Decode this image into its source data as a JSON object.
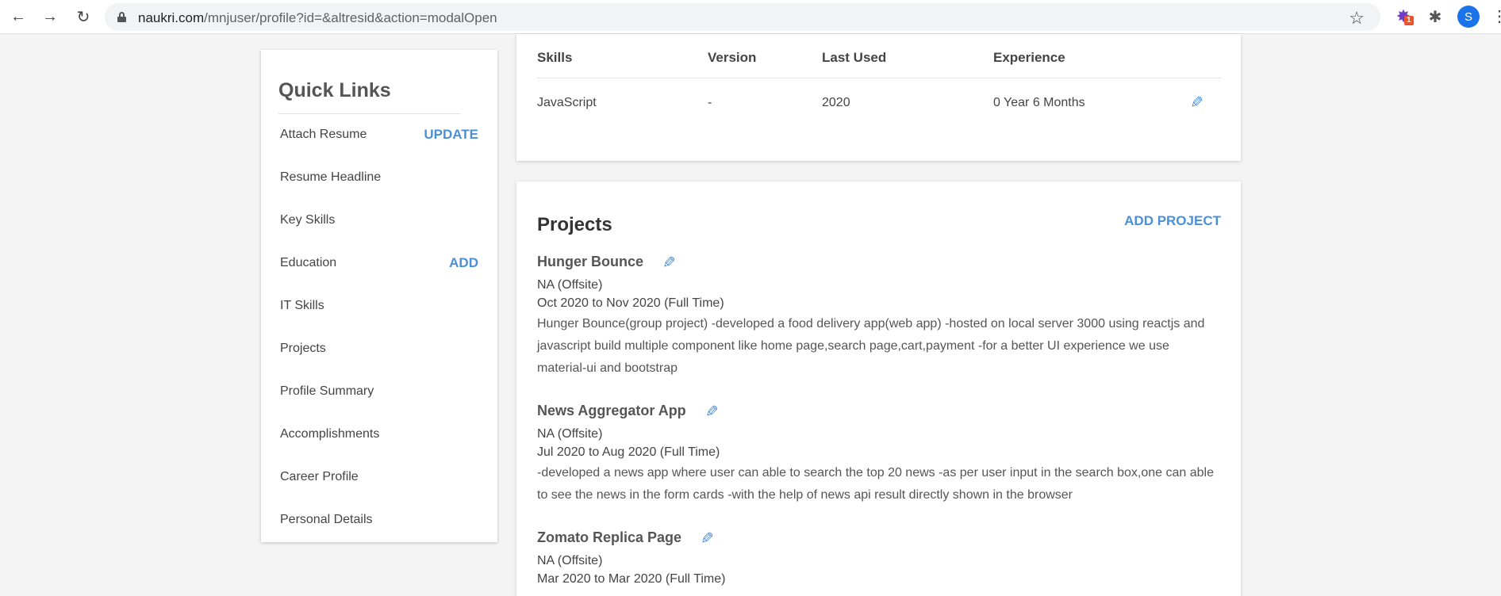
{
  "browser": {
    "url_host": "naukri.com",
    "url_path": "/mnjuser/profile?id=&altresid&action=modalOpen",
    "extension_badge": "1",
    "avatar_letter": "S"
  },
  "quick_links": {
    "title": "Quick Links",
    "items": [
      {
        "label": "Attach Resume",
        "action": "UPDATE"
      },
      {
        "label": "Resume Headline",
        "action": ""
      },
      {
        "label": "Key Skills",
        "action": ""
      },
      {
        "label": "Education",
        "action": "ADD"
      },
      {
        "label": "IT Skills",
        "action": ""
      },
      {
        "label": "Projects",
        "action": ""
      },
      {
        "label": "Profile Summary",
        "action": ""
      },
      {
        "label": "Accomplishments",
        "action": ""
      },
      {
        "label": "Career Profile",
        "action": ""
      },
      {
        "label": "Personal Details",
        "action": ""
      }
    ]
  },
  "it_skills": {
    "headers": [
      "Skills",
      "Version",
      "Last Used",
      "Experience"
    ],
    "rows": [
      {
        "skill": "JavaScript",
        "version": "-",
        "last_used": "2020",
        "experience": "0 Year 6 Months"
      }
    ]
  },
  "projects": {
    "title": "Projects",
    "add_label": "ADD PROJECT",
    "items": [
      {
        "name": "Hunger Bounce",
        "client": "NA (Offsite)",
        "duration": "Oct 2020 to Nov 2020 (Full Time)",
        "description": "Hunger Bounce(group project) -developed a food delivery app(web app) -hosted on local server 3000 using reactjs and javascript build multiple component like home page,search page,cart,payment -for a better UI experience we use material-ui and bootstrap"
      },
      {
        "name": "News Aggregator App",
        "client": "NA (Offsite)",
        "duration": "Jul 2020 to Aug 2020 (Full Time)",
        "description": "-developed a news app where user can able to search the top 20 news -as per user input in the search box,one can able to see the news in the form cards -with the help of news api result directly shown in the browser"
      },
      {
        "name": "Zomato Replica Page",
        "client": "NA (Offsite)",
        "duration": "Mar 2020 to Mar 2020 (Full Time)",
        "description": ""
      }
    ]
  }
}
